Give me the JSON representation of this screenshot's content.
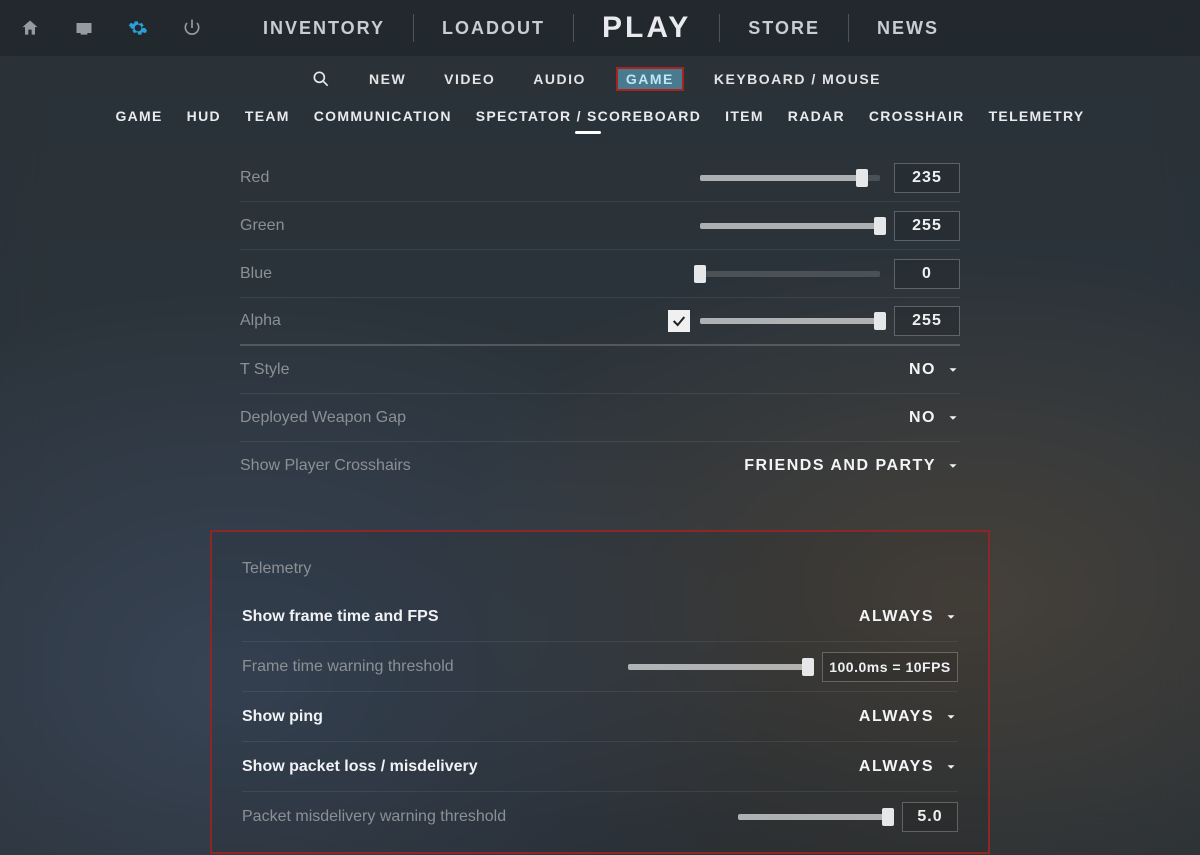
{
  "main_nav": {
    "inventory": "INVENTORY",
    "loadout": "LOADOUT",
    "play": "PLAY",
    "store": "STORE",
    "news": "NEWS"
  },
  "categories": {
    "new": "NEW",
    "video": "VIDEO",
    "audio": "AUDIO",
    "game": "GAME",
    "keyboard_mouse": "KEYBOARD / MOUSE"
  },
  "subtabs": {
    "game": "GAME",
    "hud": "HUD",
    "team": "TEAM",
    "communication": "COMMUNICATION",
    "spectator": "SPECTATOR / SCOREBOARD",
    "item": "ITEM",
    "radar": "RADAR",
    "crosshair": "CROSSHAIR",
    "telemetry": "TELEMETRY"
  },
  "crosshair": {
    "red": {
      "label": "Red",
      "value": "235",
      "pct": 90
    },
    "green": {
      "label": "Green",
      "value": "255",
      "pct": 100
    },
    "blue": {
      "label": "Blue",
      "value": "0",
      "pct": 0
    },
    "alpha": {
      "label": "Alpha",
      "value": "255",
      "pct": 100,
      "checked": true
    },
    "t_style": {
      "label": "T Style",
      "value": "NO"
    },
    "weapon_gap": {
      "label": "Deployed Weapon Gap",
      "value": "NO"
    },
    "show_player": {
      "label": "Show Player Crosshairs",
      "value": "FRIENDS AND PARTY"
    }
  },
  "telemetry": {
    "title": "Telemetry",
    "fps": {
      "label": "Show frame time and FPS",
      "value": "ALWAYS"
    },
    "frame_warn": {
      "label": "Frame time warning threshold",
      "value": "100.0ms = 10FPS",
      "pct": 100
    },
    "ping": {
      "label": "Show ping",
      "value": "ALWAYS"
    },
    "packet": {
      "label": "Show packet loss / misdelivery",
      "value": "ALWAYS"
    },
    "packet_warn": {
      "label": "Packet misdelivery warning threshold",
      "value": "5.0",
      "pct": 100
    }
  }
}
